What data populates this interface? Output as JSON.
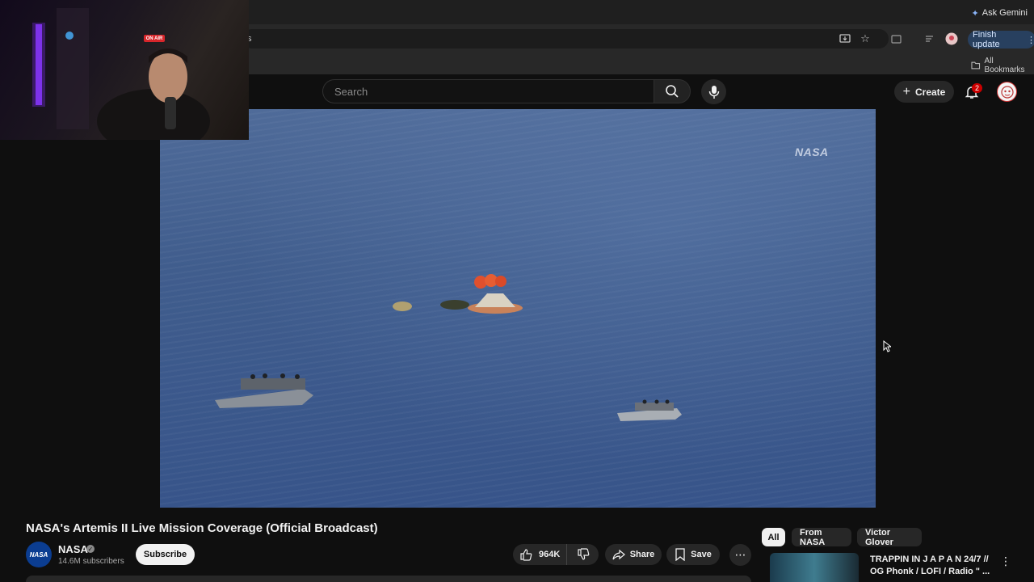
{
  "browser": {
    "ask_gemini": "Ask Gemini",
    "finish_update": "Finish update",
    "all_bookmarks": "All Bookmarks",
    "url_fragment": "s"
  },
  "youtube": {
    "search_placeholder": "Search",
    "create_label": "Create",
    "notification_count": "2"
  },
  "overlay": {
    "on_air": "ON AIR"
  },
  "player": {
    "watermark": "NASA"
  },
  "video": {
    "title": "NASA's Artemis II Live Mission Coverage (Official Broadcast)",
    "channel": "NASA",
    "channel_avatar_text": "NASA",
    "subscribers": "14.6M subscribers",
    "subscribe_label": "Subscribe",
    "likes": "964K",
    "share_label": "Share",
    "save_label": "Save"
  },
  "related": {
    "chips": [
      "All",
      "From NASA",
      "Victor Glover"
    ],
    "items": [
      {
        "title": "TRAPPIN IN  J A P A N  24/7 // OG Phonk / LOFI / Radio \" ..."
      }
    ]
  },
  "colors": {
    "accent_blue": "#28405f",
    "badge_red": "#cc0000",
    "ocean": "#405d8d"
  }
}
